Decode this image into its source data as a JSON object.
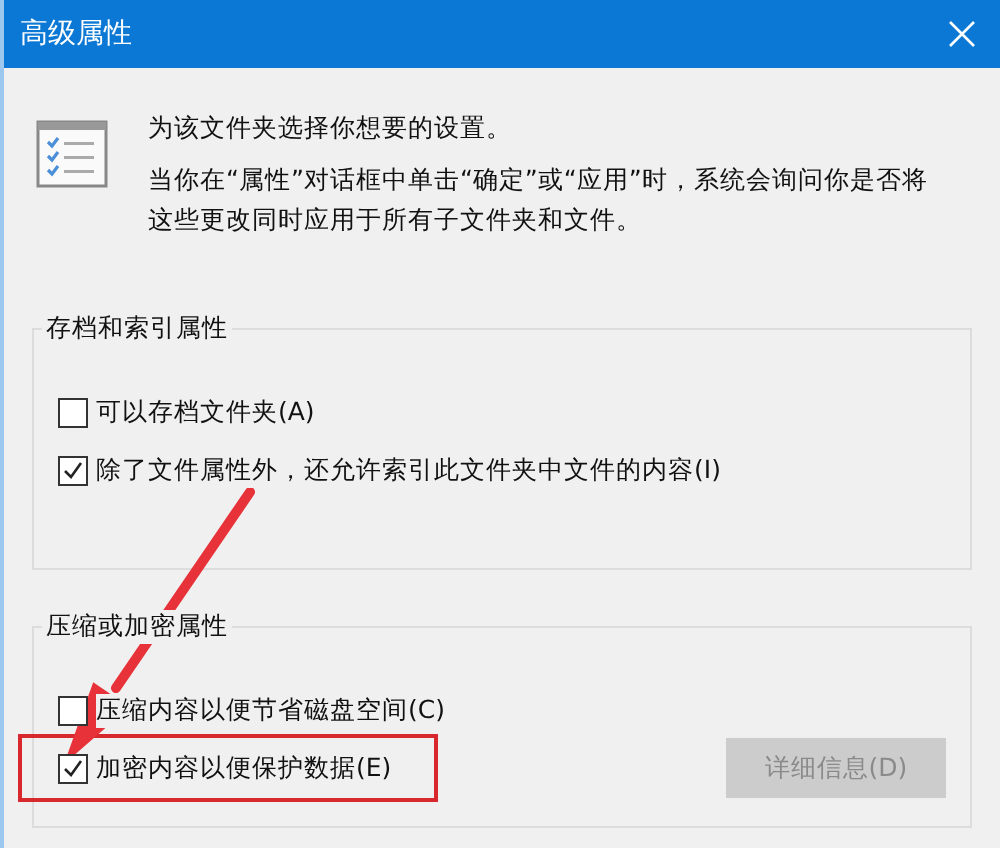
{
  "window": {
    "title": "高级属性"
  },
  "intro": {
    "lines": [
      "为该文件夹选择你想要的设置。",
      "当你在“属性”对话框中单击“确定”或“应用”时，系统会询问你是否将这些更改同时应用于所有子文件夹和文件。"
    ]
  },
  "groups": [
    {
      "title": "存档和索引属性",
      "options": [
        {
          "label": "可以存档文件夹(A)",
          "checked": false,
          "highlighted": false
        },
        {
          "label": "除了文件属性外，还允许索引此文件夹中文件的内容(I)",
          "checked": true,
          "highlighted": false
        }
      ]
    },
    {
      "title": "压缩或加密属性",
      "options": [
        {
          "label": "压缩内容以便节省磁盘空间(C)",
          "checked": false,
          "highlighted": false
        },
        {
          "label": "加密内容以便保护数据(E)",
          "checked": true,
          "highlighted": true
        }
      ],
      "button": {
        "label": "详细信息(D)",
        "disabled": true
      }
    }
  ]
}
